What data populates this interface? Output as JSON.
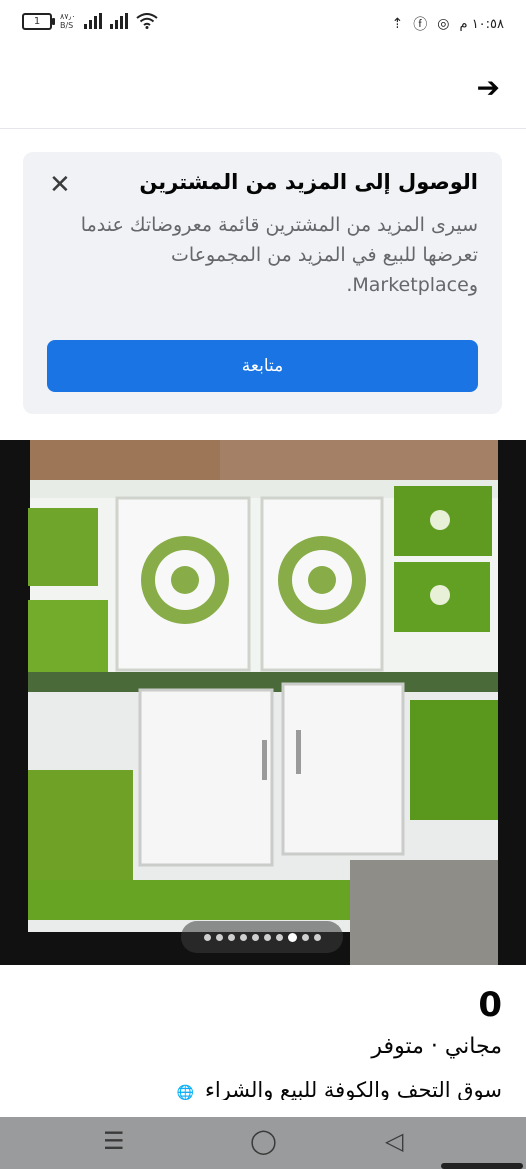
{
  "status_bar": {
    "battery": "1",
    "net_speed": "٨٧٫٠",
    "net_unit": "B/S",
    "time": "١٠:٥٨ م"
  },
  "header": {
    "back_icon": "arrow-right-icon"
  },
  "promo": {
    "title": "الوصول إلى المزيد من المشترين",
    "body": "سيرى المزيد من المشترين قائمة معروضاتك عندما تعرضها للبيع في المزيد من المجموعات وMarketplace.",
    "button_label": "متابعة",
    "close_icon": "close-icon",
    "accent": "#1b74e4"
  },
  "photo": {
    "carousel_count": 10,
    "carousel_active_index": 7
  },
  "listing": {
    "price": "0",
    "subtitle": "مجاني · متوفر",
    "seller_line": "سوق التحف والكوفة للبيع والشراء"
  },
  "navbar": {
    "recent_icon": "recent-apps-icon",
    "home_icon": "home-icon",
    "back_icon": "back-icon"
  }
}
